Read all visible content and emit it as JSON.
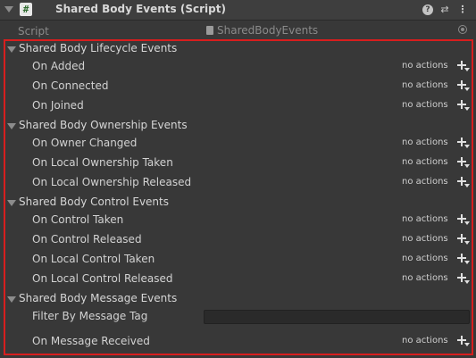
{
  "header": {
    "title": "Shared Body Events (Script)",
    "script_icon_glyph": "#",
    "help_glyph": "?",
    "preset_glyph": "⇄",
    "menu_glyph": "⋮"
  },
  "script_row": {
    "label": "Script",
    "value": "SharedBodyEvents"
  },
  "no_actions_text": "no actions",
  "groups": [
    {
      "title": "Shared Body Lifecycle Events",
      "events": [
        "On Added",
        "On Connected",
        "On Joined"
      ]
    },
    {
      "title": "Shared Body Ownership Events",
      "events": [
        "On Owner Changed",
        "On Local Ownership Taken",
        "On Local Ownership Released"
      ]
    },
    {
      "title": "Shared Body Control Events",
      "events": [
        "On Control Taken",
        "On Control Released",
        "On Local Control Taken",
        "On Local Control Released"
      ]
    },
    {
      "title": "Shared Body Message Events",
      "filter_label": "Filter By Message Tag",
      "filter_value": "",
      "events": [
        "On Message Received"
      ]
    }
  ],
  "colors": {
    "background": "#383838",
    "highlight_border": "#d81e1e",
    "text": "#d2d2d2"
  }
}
